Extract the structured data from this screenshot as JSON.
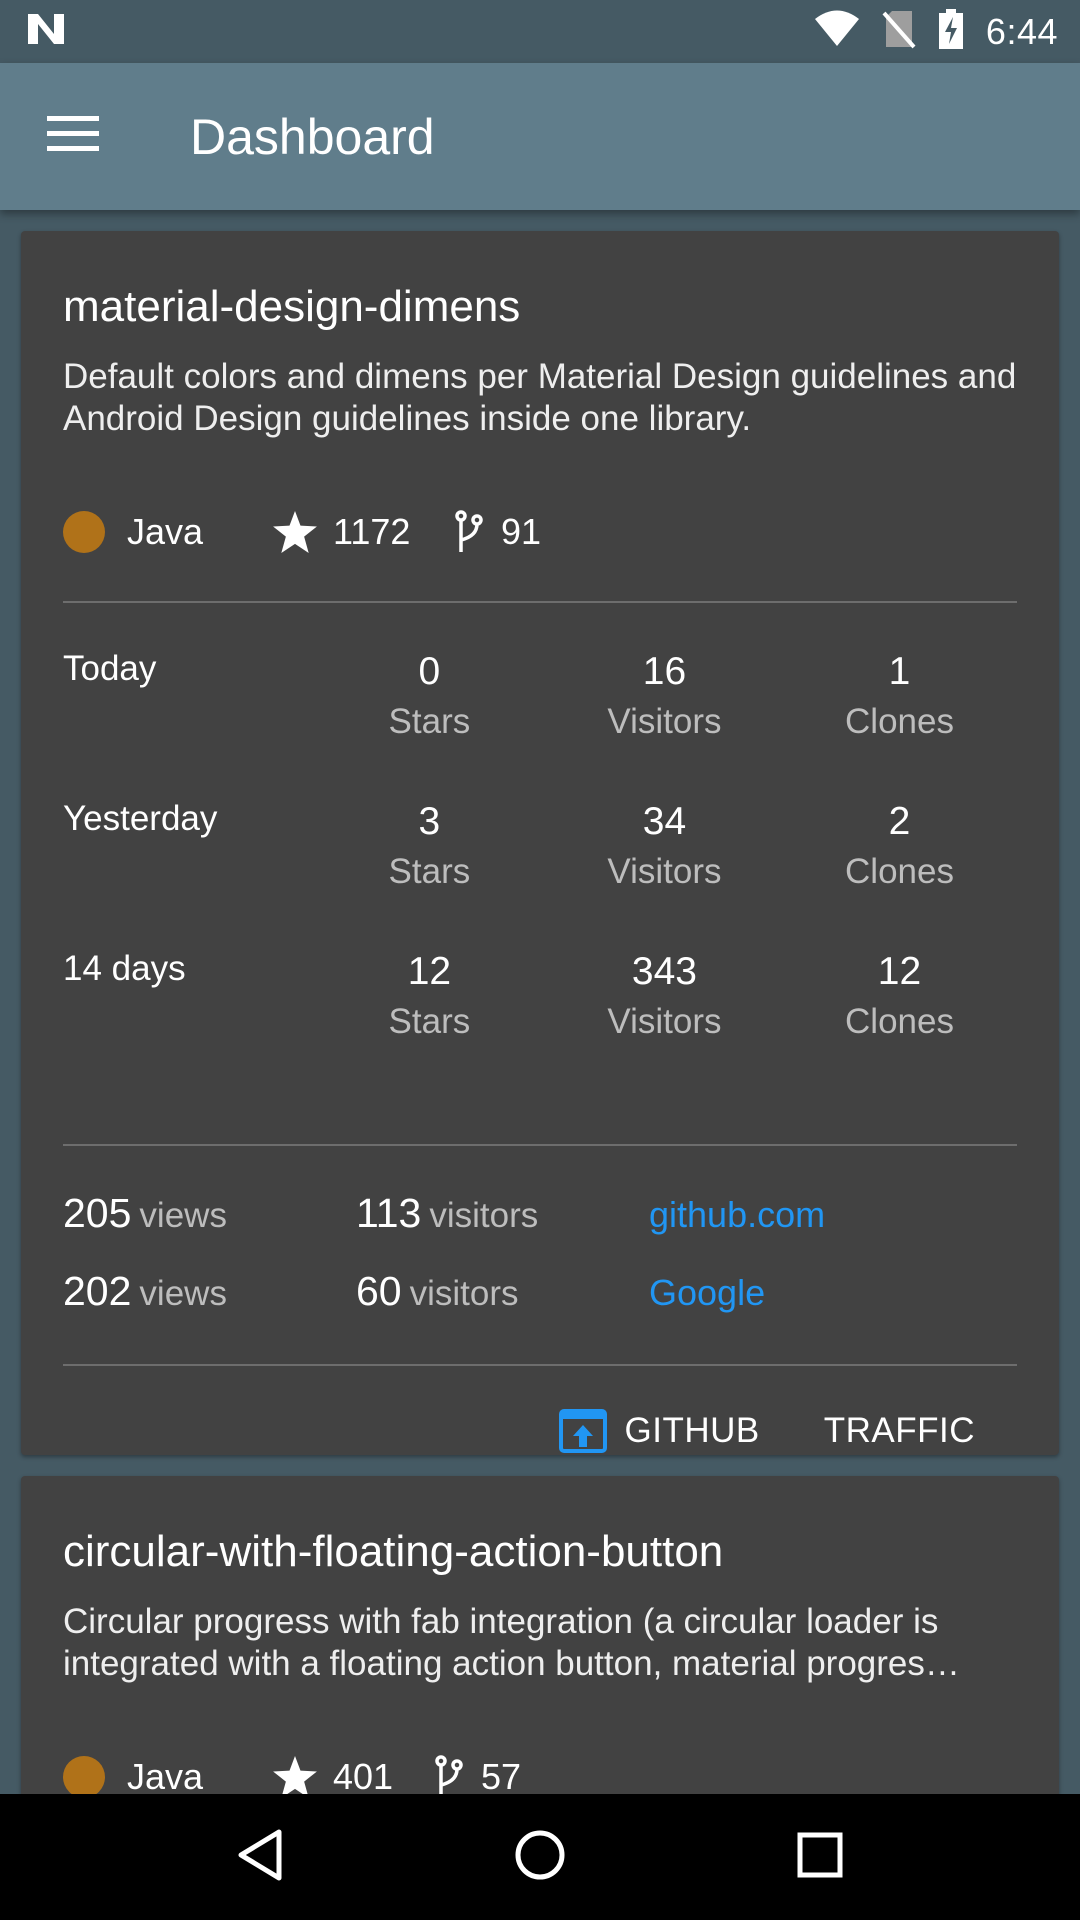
{
  "status_bar": {
    "time": "6:44",
    "icons": [
      "n-logo-icon",
      "wifi-icon",
      "no-sim-icon",
      "battery-charging-icon"
    ]
  },
  "app_bar": {
    "title": "Dashboard",
    "menu_icon": "hamburger-menu-icon"
  },
  "colors": {
    "background": "#455a64",
    "app_bar": "#607d8b",
    "card": "#424242",
    "java": "#b07219",
    "link": "#2196f3",
    "action_icon": "#2196f3"
  },
  "repos": [
    {
      "name": "material-design-dimens",
      "description": "Default colors and dimens per Material Design guidelines and Android Design guidelines inside one library.",
      "language": "Java",
      "stars": "1172",
      "forks": "91",
      "stats": [
        {
          "label": "Today",
          "stars": "0",
          "visitors": "16",
          "clones": "1"
        },
        {
          "label": "Yesterday",
          "stars": "3",
          "visitors": "34",
          "clones": "2"
        },
        {
          "label": "14 days",
          "stars": "12",
          "visitors": "343",
          "clones": "12"
        }
      ],
      "stat_units": {
        "stars": "Stars",
        "visitors": "Visitors",
        "clones": "Clones"
      },
      "referrers": [
        {
          "views": "205",
          "views_unit": "views",
          "visitors": "113",
          "visitors_unit": "visitors",
          "source": "github.com"
        },
        {
          "views": "202",
          "views_unit": "views",
          "visitors": "60",
          "visitors_unit": "visitors",
          "source": "Google"
        }
      ],
      "actions": {
        "github": "GITHUB",
        "traffic": "TRAFFIC"
      }
    },
    {
      "name": "circular-with-floating-action-button",
      "description": "Circular progress with fab integration (a circular loader is integrated with a floating action button, material progres…",
      "language": "Java",
      "stars": "401",
      "forks": "57"
    }
  ],
  "nav_bar": {
    "icons": [
      "back-icon",
      "home-icon",
      "recents-icon"
    ]
  }
}
